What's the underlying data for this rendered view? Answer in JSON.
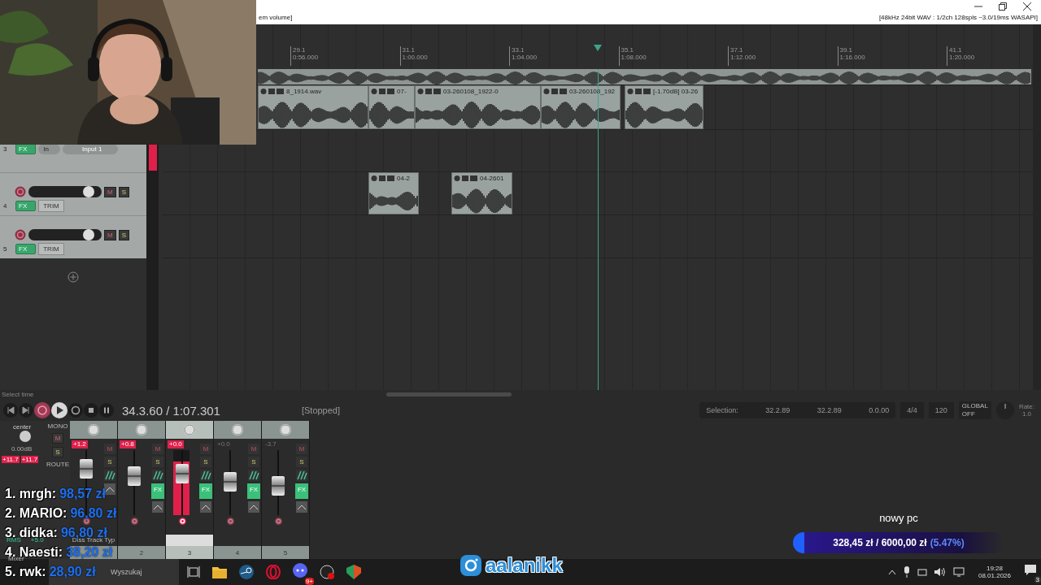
{
  "title_bar": {
    "left_text": "em volume]",
    "right_text": "[48kHz 24bit WAV : 1/2ch 128spls ~3.0/19ms WASAPI]"
  },
  "ruler": [
    {
      "bar": "29.1",
      "time": "0:56.000"
    },
    {
      "bar": "31.1",
      "time": "1:00.000"
    },
    {
      "bar": "33.1",
      "time": "1:04.000"
    },
    {
      "bar": "35.1",
      "time": "1:08.000"
    },
    {
      "bar": "37.1",
      "time": "1:12.000"
    },
    {
      "bar": "39.1",
      "time": "1:16.000"
    },
    {
      "bar": "41.1",
      "time": "1:20.000"
    }
  ],
  "tracks": [
    {
      "kind": "input",
      "number": "3",
      "fx": "FX",
      "input_mode": "In",
      "input": "Input 1",
      "armed": true
    },
    {
      "kind": "audio",
      "number": "4",
      "fx": "FX",
      "mute": "M",
      "solo": "S",
      "trim": "TRIM",
      "level": 0.9
    },
    {
      "kind": "audio",
      "number": "5",
      "fx": "FX",
      "mute": "M",
      "solo": "S",
      "trim": "TRIM",
      "level": 0.9
    }
  ],
  "lanes": [
    {
      "items": [
        {
          "kind": "long"
        }
      ]
    },
    {
      "items": [
        {
          "label": "8_1914.wav"
        },
        {
          "label": "07-"
        },
        {
          "label": "03-260108_1922-0"
        },
        {
          "label": "03-260108_192"
        },
        {
          "label": "[-1.70dB] 03-26"
        }
      ]
    },
    {
      "items": [
        {
          "label": "04-2"
        },
        {
          "label": "04-2601"
        }
      ]
    }
  ],
  "transport": {
    "select_label": "Select time",
    "position": "34.3.60 / 1:07.301",
    "state": "[Stopped]"
  },
  "selection": {
    "label": "Selection:",
    "start": "32.2.89",
    "end": "32.2.89",
    "length": "0.0.00"
  },
  "time_signature": "4/4",
  "tempo": "120",
  "automation": {
    "label": "GLOBAL",
    "value": "OFF"
  },
  "rate": {
    "label": "Rate:",
    "value": "1.0"
  },
  "master": {
    "pan_label": "center",
    "volume": "0.00dB",
    "peak_left": "+11.7",
    "peak_right": "+11.7",
    "mono": "MONO",
    "mute": "M",
    "solo": "S",
    "route": "ROUTE",
    "rms": "RMS",
    "rms_value": "+5.0",
    "tab": "Mixer"
  },
  "channels": [
    {
      "peak": "+1.2",
      "clipped": true,
      "level": 0.72,
      "selected": false,
      "armed": false,
      "mute": "M",
      "solo": "S",
      "name": "Diss Track Typ"
    },
    {
      "peak": "+0.8",
      "clipped": true,
      "level": 0.62,
      "selected": false,
      "armed": false,
      "mute": "M",
      "solo": "S",
      "fx": "FX",
      "number": "2"
    },
    {
      "peak": "+0.0",
      "clipped": true,
      "level": 0.66,
      "selected": true,
      "armed": true,
      "mute": "M",
      "solo": "S",
      "fx": "FX",
      "number": "3",
      "meter": {
        "level": 0.82
      }
    },
    {
      "peak": "+0.0",
      "clipped": false,
      "level": 0.55,
      "selected": false,
      "armed": false,
      "mute": "M",
      "solo": "S",
      "fx": "FX",
      "number": "4"
    },
    {
      "peak": "-3.7",
      "clipped": false,
      "level": 0.5,
      "selected": false,
      "armed": false,
      "mute": "M",
      "solo": "S",
      "fx": "FX",
      "number": "5"
    }
  ],
  "donations": [
    {
      "name": "1. mrgh:",
      "amount": "98,57 zł"
    },
    {
      "name": "2. MARIO:",
      "amount": "96,80 zł"
    },
    {
      "name": "3. didka:",
      "amount": "96,80 zł"
    },
    {
      "name": "4. Naesti:",
      "amount": "38,20 zł"
    },
    {
      "name": "5. rwk:",
      "amount": "28,90 zł"
    }
  ],
  "logo": {
    "name": "aalanikk"
  },
  "goal": {
    "title": "nowy pc",
    "amounts": "328,45 zł / 6000,00 zł",
    "percent": "(5.47%)",
    "level": 0.0547
  },
  "taskbar": {
    "search_placeholder": "Wyszukaj",
    "chat_badge": "9+",
    "time": "19:28",
    "date": "08.01.2026",
    "notifications": "3"
  }
}
